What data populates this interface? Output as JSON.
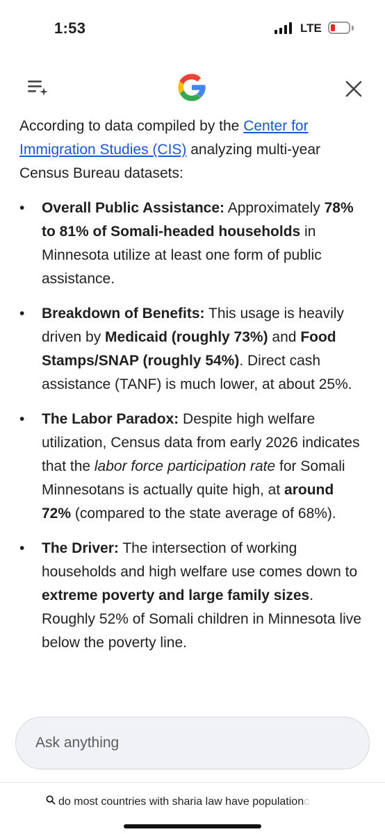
{
  "status_bar": {
    "time": "1:53",
    "network": "LTE",
    "battery_color": "#e0281e"
  },
  "header": {
    "menu_icon": "menu-sparkle-icon",
    "logo_icon": "google-g-logo",
    "close_icon": "close-icon"
  },
  "article": {
    "intro": {
      "before": "According to data compiled by the ",
      "link": "Center for Immigration Studies (CIS)",
      "after": " analyzing multi-year Census Bureau datasets:"
    },
    "bullets": [
      {
        "title": "Overall Public Assistance:",
        "t1": " Approximately ",
        "b1": "78% to 81% of Somali-headed households",
        "t2": " in Minnesota utilize at least one form of public assistance."
      },
      {
        "title": "Breakdown of Benefits:",
        "t1": " This usage is heavily driven by ",
        "b1": "Medicaid (roughly 73%)",
        "t2": " and ",
        "b2": "Food Stamps/SNAP (roughly 54%)",
        "t3": ". Direct cash assistance (TANF) is much lower, at about 25%."
      },
      {
        "title": "The Labor Paradox:",
        "t1": " Despite high welfare utilization, Census data from early 2026 indicates that the ",
        "i1": "labor force participation rate",
        "t2": " for Somali Minnesotans is actually quite high, at ",
        "b1": "around 72%",
        "t3": " (compared to the state average of 68%)."
      },
      {
        "title": "The Driver:",
        "t1": " The intersection of working households and high welfare use comes down to ",
        "b1": "extreme poverty and large family sizes",
        "t2": ". Roughly 52% of Somali children in Minnesota live below the poverty line."
      }
    ]
  },
  "input": {
    "placeholder": "Ask anything"
  },
  "bottom": {
    "query": "do most countries with sharia law have population",
    "query_fade": "c",
    "icon": "search-icon"
  },
  "colors": {
    "link": "#1a56d6",
    "input_bg": "#f0f2f5",
    "google_blue": "#4285F4",
    "google_red": "#EA4335",
    "google_yellow": "#FBBC05",
    "google_green": "#34A853"
  }
}
